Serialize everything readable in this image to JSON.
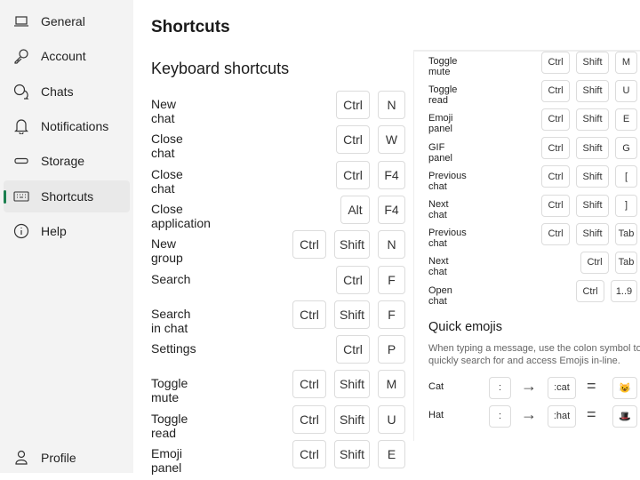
{
  "sidebar": {
    "items": [
      {
        "label": "General",
        "icon": "laptop-icon"
      },
      {
        "label": "Account",
        "icon": "key-icon"
      },
      {
        "label": "Chats",
        "icon": "chat-icon"
      },
      {
        "label": "Notifications",
        "icon": "bell-icon"
      },
      {
        "label": "Storage",
        "icon": "storage-icon"
      },
      {
        "label": "Shortcuts",
        "icon": "keyboard-icon",
        "active": true
      },
      {
        "label": "Help",
        "icon": "info-icon"
      }
    ],
    "profile": {
      "label": "Profile",
      "icon": "person-icon"
    },
    "accent": "#1b7f4f"
  },
  "main": {
    "title": "Shortcuts",
    "section": "Keyboard shortcuts",
    "shortcuts": [
      {
        "label": "New chat",
        "keys": [
          "Ctrl",
          "N"
        ]
      },
      {
        "label": "Close chat",
        "keys": [
          "Ctrl",
          "W"
        ]
      },
      {
        "label": "Close chat",
        "keys": [
          "Ctrl",
          "F4"
        ]
      },
      {
        "label": "Close application",
        "keys": [
          "Alt",
          "F4"
        ]
      },
      {
        "label": "New group",
        "keys": [
          "Ctrl",
          "Shift",
          "N"
        ]
      },
      {
        "label": "Search",
        "keys": [
          "Ctrl",
          "F"
        ]
      },
      {
        "label": "Search in chat",
        "keys": [
          "Ctrl",
          "Shift",
          "F"
        ]
      },
      {
        "label": "Settings",
        "keys": [
          "Ctrl",
          "P"
        ]
      },
      {
        "label": "Toggle mute",
        "keys": [
          "Ctrl",
          "Shift",
          "M"
        ]
      },
      {
        "label": "Toggle read",
        "keys": [
          "Ctrl",
          "Shift",
          "U"
        ]
      },
      {
        "label": "Emoji panel",
        "keys": [
          "Ctrl",
          "Shift",
          "E"
        ]
      }
    ]
  },
  "panel": {
    "shortcuts": [
      {
        "label": "Toggle mute",
        "keys": [
          "Ctrl",
          "Shift",
          "M"
        ]
      },
      {
        "label": "Toggle read",
        "keys": [
          "Ctrl",
          "Shift",
          "U"
        ]
      },
      {
        "label": "Emoji panel",
        "keys": [
          "Ctrl",
          "Shift",
          "E"
        ]
      },
      {
        "label": "GIF panel",
        "keys": [
          "Ctrl",
          "Shift",
          "G"
        ]
      },
      {
        "label": "Previous chat",
        "keys": [
          "Ctrl",
          "Shift",
          "["
        ]
      },
      {
        "label": "Next chat",
        "keys": [
          "Ctrl",
          "Shift",
          "]"
        ]
      },
      {
        "label": "Previous chat",
        "keys": [
          "Ctrl",
          "Shift",
          "Tab"
        ]
      },
      {
        "label": "Next chat",
        "keys": [
          "Ctrl",
          "Tab"
        ]
      },
      {
        "label": "Open chat",
        "keys": [
          "Ctrl",
          "1..9"
        ]
      }
    ],
    "quick_emojis": {
      "title": "Quick emojis",
      "description": "When typing a message, use the colon symbol to quickly search for and access Emojis in-line.",
      "items": [
        {
          "label": "Cat",
          "trigger": ":",
          "code": ":cat",
          "emoji": "😺"
        },
        {
          "label": "Hat",
          "trigger": ":",
          "code": ":hat",
          "emoji": "🎩"
        }
      ]
    }
  }
}
